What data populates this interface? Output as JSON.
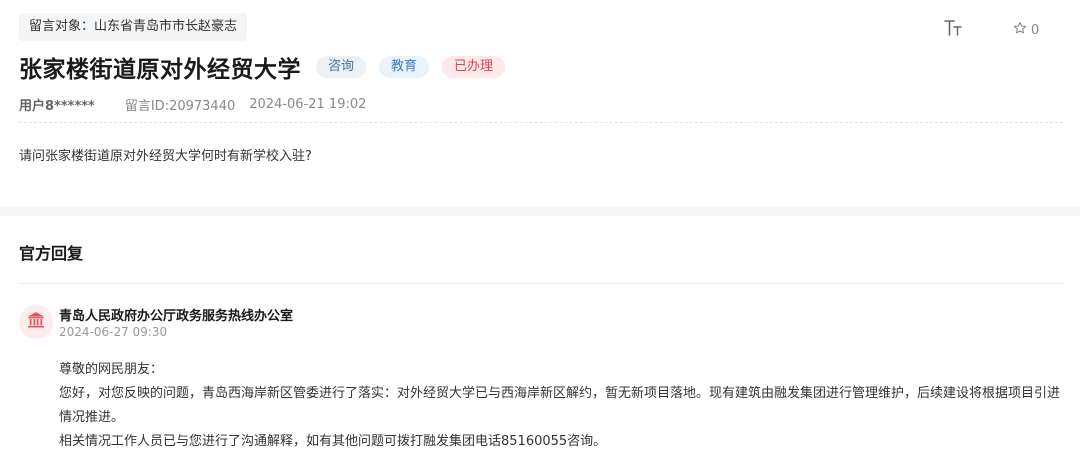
{
  "message": {
    "target_label": "留言对象：山东省青岛市市长赵豪志",
    "title": "张家楼街道原对外经贸大学",
    "badges": {
      "consult": "咨询",
      "education": "教育",
      "status": "已办理"
    },
    "user": "用户8******",
    "message_id": "留言ID:20973440",
    "time": "2024-06-21 19:02",
    "question": "请问张家楼街道原对外经贸大学何时有新学校入驻?",
    "favorite_count": "0"
  },
  "reply": {
    "heading": "官方回复",
    "org_name": "青岛人民政府办公厅政务服务热线办公室",
    "time": "2024-06-27 09:30",
    "greeting": "尊敬的网民朋友：",
    "paragraph1": "您好，对您反映的问题，青岛西海岸新区管委进行了落实：对外经贸大学已与西海岸新区解约，暂无新项目落地。现有建筑由融发集团进行管理维护，后续建设将根据项目引进情况推进。",
    "paragraph2": "相关情况工作人员已与您进行了沟通解释，如有其他问题可拨打融发集团电话85160055咨询。"
  },
  "icons": {
    "font_size": "font-size-icon",
    "favorite": "star-outline-icon",
    "org": "government-building-icon"
  },
  "colors": {
    "status_red": "#d9444f",
    "education_blue": "#3a7fc0",
    "consult_blue": "#4a6f9a",
    "org_icon": "#e0555f"
  }
}
